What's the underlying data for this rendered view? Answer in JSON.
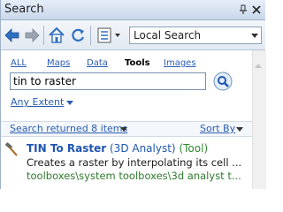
{
  "window": {
    "title": "Search"
  },
  "toolbar": {
    "search_scope": "Local Search"
  },
  "tabs": [
    {
      "label": "ALL",
      "active": false
    },
    {
      "label": "Maps",
      "active": false
    },
    {
      "label": "Data",
      "active": false
    },
    {
      "label": "Tools",
      "active": true
    },
    {
      "label": "Images",
      "active": false
    }
  ],
  "search": {
    "query": "tin to raster",
    "extent_label": "Any Extent"
  },
  "results_header": {
    "count_label": "Search returned 8 items",
    "sort_label": "Sort By"
  },
  "result": {
    "name": "TIN To Raster",
    "group": "(3D Analyst)",
    "type": "(Tool)",
    "description": "Creates a raster by interpolating its cell ...",
    "path": "toolboxes\\system toolboxes\\3d analyst t..."
  },
  "colors": {
    "link": "#2a5db0",
    "result_title": "#1f55b0",
    "result_path": "#2f7a2f"
  }
}
